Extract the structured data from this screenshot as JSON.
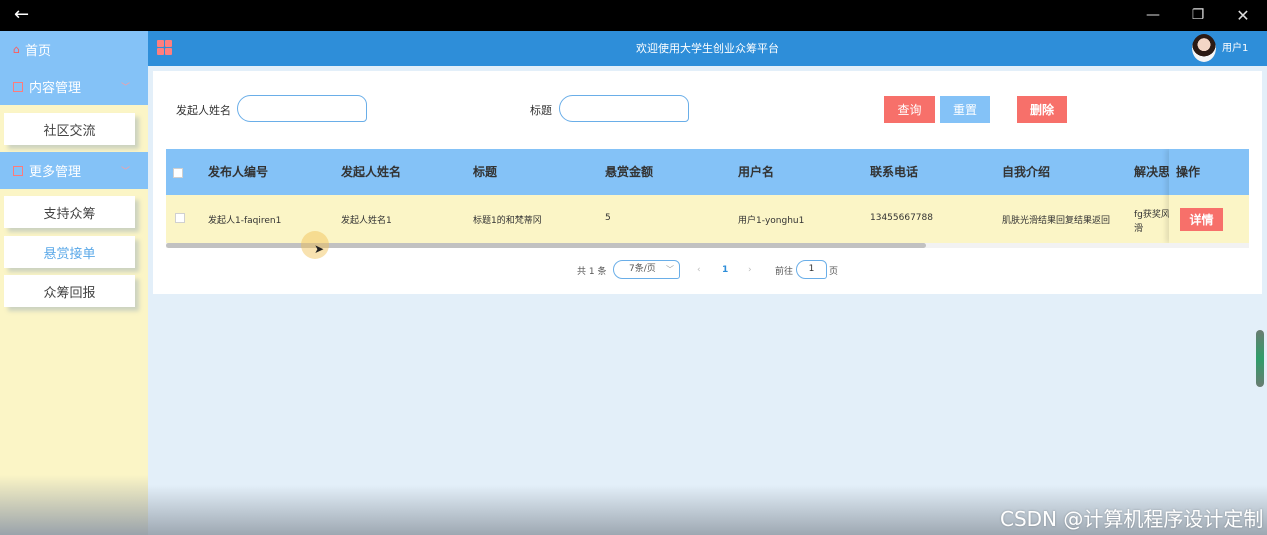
{
  "window": {
    "back_icon": "arrow-left-icon",
    "min_icon": "minimize-icon",
    "max_icon": "restore-icon",
    "close_icon": "close-icon"
  },
  "sidebar": {
    "home": "首页",
    "content_mgmt": "内容管理",
    "community": "社区交流",
    "more_mgmt": "更多管理",
    "items": [
      "支持众筹",
      "悬赏接单",
      "众筹回报"
    ]
  },
  "header": {
    "title": "欢迎使用大学生创业众筹平台",
    "username": "用户1"
  },
  "search": {
    "name_label": "发起人姓名",
    "name_value": "",
    "title_label": "标题",
    "title_value": "",
    "query_btn": "查询",
    "reset_btn": "重置",
    "delete_btn": "删除"
  },
  "table": {
    "columns": [
      "发布人编号",
      "发起人姓名",
      "标题",
      "悬赏金额",
      "用户名",
      "联系电话",
      "自我介绍",
      "解决思",
      "操作"
    ],
    "rows": [
      {
        "publisher_id": "发起人1-faqiren1",
        "name": "发起人姓名1",
        "title": "标题1的和梵蒂冈",
        "amount": "5",
        "username": "用户1-yonghu1",
        "phone": "13455667788",
        "intro": "肌肤光滑结果回复结果返回",
        "solution_line1": "fg获奖风",
        "solution_line2": "滑",
        "action": "详情"
      }
    ]
  },
  "pagination": {
    "total": "共 1 条",
    "page_size": "7条/页",
    "prev": "‹",
    "current": "1",
    "next": "›",
    "goto_label": "前往",
    "goto_value": "1",
    "page_suffix": "页"
  },
  "watermark": "CSDN @计算机程序设计定制"
}
